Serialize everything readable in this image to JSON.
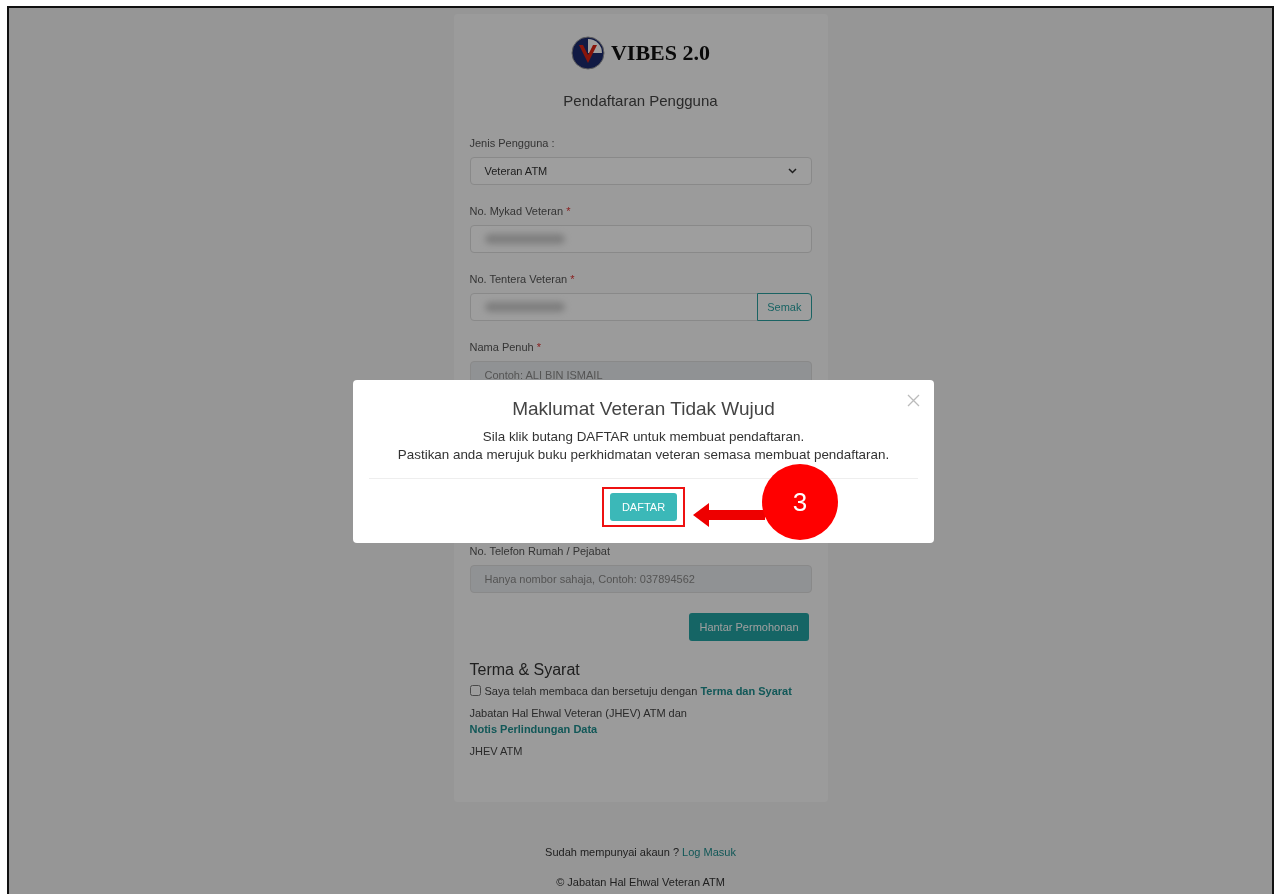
{
  "brand": {
    "title": "VIBES 2.0"
  },
  "heading": "Pendaftaran Pengguna",
  "fields": [
    {
      "kind": "select",
      "label": "Jenis Pengguna :",
      "value": "Veteran ATM"
    },
    {
      "kind": "text",
      "label": "No. Mykad Veteran",
      "required_mark": "*",
      "redacted": true
    },
    {
      "kind": "check",
      "label": "No. Tentera Veteran",
      "required_mark": "*",
      "redacted": true,
      "button": "Semak"
    },
    {
      "kind": "text",
      "label": "Nama Penuh",
      "required_mark": "*",
      "placeholder": "Contoh: ALI BIN ISMAIL",
      "disabled": true
    },
    {
      "kind": "gap"
    },
    {
      "kind": "text",
      "label": "No. Telefon Rumah / Pejabat",
      "placeholder": "Hanya nombor sahaja, Contoh: 037894562",
      "disabled": true
    }
  ],
  "submit_button": "Hantar Permohonan",
  "terms": {
    "title": "Terma & Syarat",
    "checked": false,
    "agree_text": "Saya telah membaca dan bersetuju dengan",
    "agree_link": "Terma dan Syarat",
    "notice_text": "Jabatan Hal Ehwal Veteran (JHEV) ATM dan",
    "notice_link": "Notis Perlindungan Data",
    "owner": "JHEV ATM"
  },
  "footer": {
    "account_text": "Sudah mempunyai akaun ?",
    "login_link": "Log Masuk",
    "copyright": "© Jabatan Hal Ehwal Veteran ATM"
  },
  "modal": {
    "title": "Maklumat Veteran Tidak Wujud",
    "lines": [
      "Sila klik butang DAFTAR untuk membuat pendaftaran.",
      "Pastikan anda merujuk buku perkhidmatan veteran semasa membuat pendaftaran."
    ],
    "button": "DAFTAR"
  },
  "annotation": {
    "step": "3"
  }
}
